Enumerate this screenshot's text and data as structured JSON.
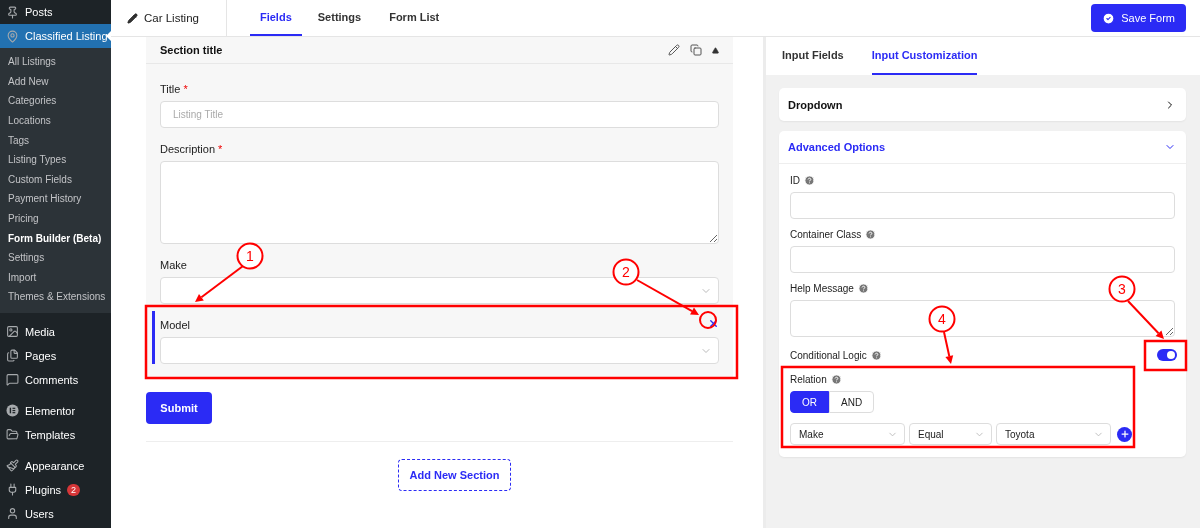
{
  "sidebar": {
    "groups": [
      {
        "items": [
          {
            "label": "Posts",
            "selected": false
          },
          {
            "label": "Classified Listing",
            "selected": true,
            "children": [
              {
                "label": "All Listings",
                "selected": false
              },
              {
                "label": "Add New",
                "selected": false
              },
              {
                "label": "Categories",
                "selected": false
              },
              {
                "label": "Locations",
                "selected": false
              },
              {
                "label": "Tags",
                "selected": false
              },
              {
                "label": "Listing Types",
                "selected": false
              },
              {
                "label": "Custom Fields",
                "selected": false
              },
              {
                "label": "Payment History",
                "selected": false
              },
              {
                "label": "Pricing",
                "selected": false
              },
              {
                "label": "Form Builder (Beta)",
                "selected": true
              },
              {
                "label": "Settings",
                "selected": false
              },
              {
                "label": "Import",
                "selected": false
              },
              {
                "label": "Themes & Extensions",
                "selected": false
              }
            ]
          }
        ]
      },
      {
        "items": [
          {
            "label": "Media",
            "selected": false
          },
          {
            "label": "Pages",
            "selected": false
          },
          {
            "label": "Comments",
            "selected": false
          }
        ]
      },
      {
        "items": [
          {
            "label": "Elementor",
            "selected": false
          },
          {
            "label": "Templates",
            "selected": false
          }
        ]
      },
      {
        "items": [
          {
            "label": "Appearance",
            "selected": false
          },
          {
            "label": "Plugins",
            "selected": false,
            "badge": "2"
          },
          {
            "label": "Users",
            "selected": false
          }
        ]
      }
    ]
  },
  "topbar": {
    "form_name": "Car Listing",
    "tabs": [
      {
        "label": "Fields",
        "selected": true
      },
      {
        "label": "Settings",
        "selected": false
      },
      {
        "label": "Form List",
        "selected": false
      }
    ],
    "save_button": "Save Form"
  },
  "section": {
    "title": "Section title",
    "fields": [
      {
        "kind": "text",
        "label": "Title",
        "required_mark": "*",
        "placeholder": "Listing Title",
        "active": false
      },
      {
        "kind": "textarea",
        "label": "Description",
        "required_mark": "*",
        "active": false
      },
      {
        "kind": "select",
        "label": "Make",
        "active": false
      },
      {
        "kind": "select",
        "label": "Model",
        "active": true
      }
    ]
  },
  "submit_button": "Submit",
  "add_section_button": "Add New Section",
  "panel": {
    "tabs": [
      {
        "label": "Input Fields",
        "selected": false
      },
      {
        "label": "Input Customization",
        "selected": true
      }
    ],
    "cards": [
      {
        "title": "Dropdown",
        "expanded": false
      },
      {
        "title": "Advanced Options",
        "expanded": true
      }
    ],
    "options": [
      {
        "kind": "text",
        "label": "ID",
        "help": true
      },
      {
        "kind": "text",
        "label": "Container Class",
        "help": true
      },
      {
        "kind": "textarea",
        "label": "Help Message",
        "help": true
      },
      {
        "kind": "toggle",
        "label": "Conditional Logic",
        "help": true,
        "on": true
      }
    ],
    "relation": {
      "label": "Relation",
      "help": true,
      "options": [
        {
          "label": "OR",
          "selected": true
        },
        {
          "label": "AND",
          "selected": false
        }
      ]
    },
    "condition_rows": [
      {
        "selects": [
          "Make",
          "Equal",
          "Toyota"
        ]
      }
    ]
  },
  "annotations": [
    {
      "label": "1"
    },
    {
      "label": "2"
    },
    {
      "label": "3"
    },
    {
      "label": "4"
    }
  ]
}
